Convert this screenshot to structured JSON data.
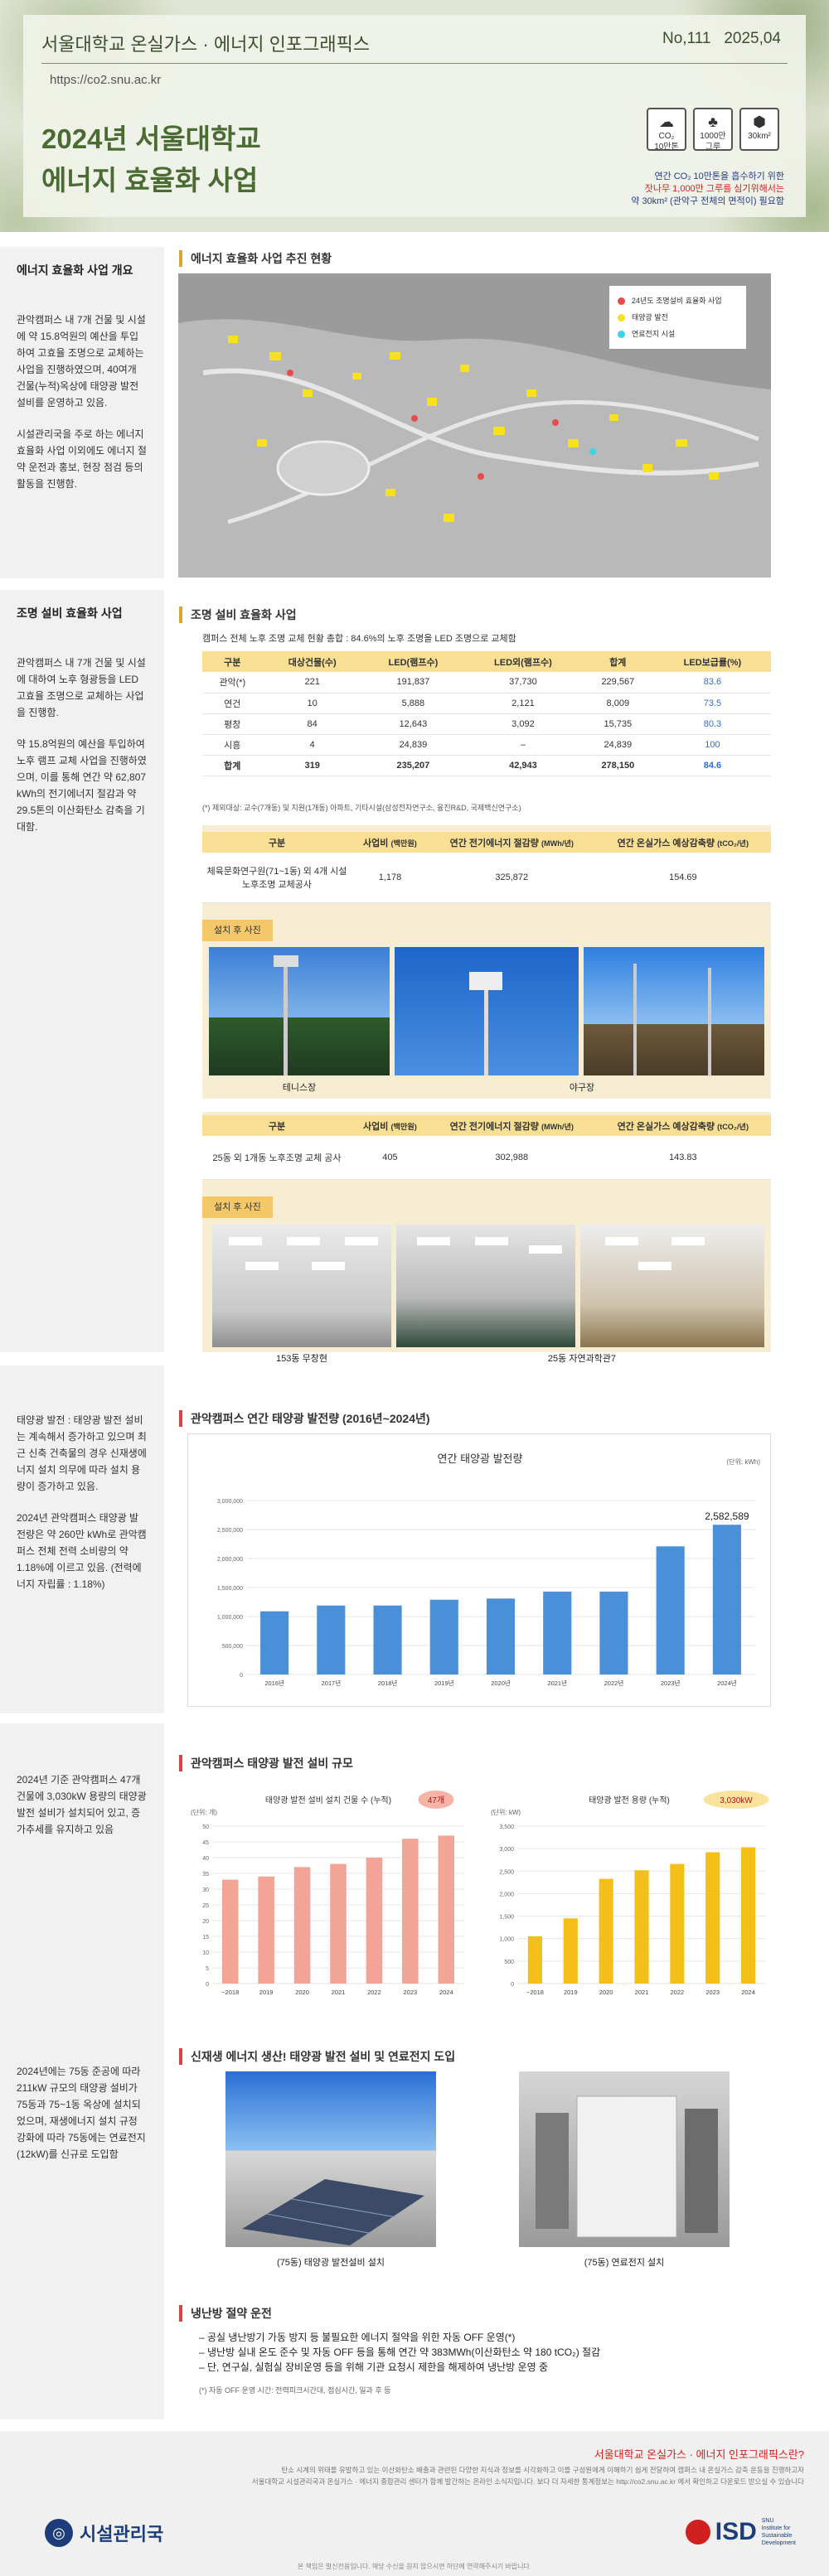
{
  "header": {
    "title": "서울대학교 온실가스 · 에너지 인포그래픽스",
    "number": "No,111",
    "date": "2025,04",
    "url": "https://co2.snu.ac.kr",
    "main_line1": "2024년 서울대학교",
    "main_line2": "에너지 효율화 사업",
    "badges": [
      {
        "icon": "co2-cloud-icon",
        "value": "CO₂",
        "sub": "10만톤"
      },
      {
        "icon": "tree-icon",
        "value": "1000만",
        "sub": "그루"
      },
      {
        "icon": "area-icon",
        "value": "30km²",
        "sub": ""
      }
    ],
    "note_line1": "연간 CO₂ 10만톤을 흡수하기 위한",
    "note_line2": "잣나무 1,000만 그루를 심기위해서는",
    "note_line3": "약 30km² (관악구 전체의 면적이) 필요함"
  },
  "section1": {
    "side_title": "에너지 효율화 사업 개요",
    "side_p1": "관악캠퍼스 내 7개 건물 및 시설에 약 15.8억원의 예산을 투입하여 고효율 조명으로 교체하는 사업을 진행하였으며, 40여개 건물(누적)옥상에 태양광 발전 설비를 운영하고 있음.",
    "side_p2": "시설관리국을 주로 하는 에너지 효율화 사업 이외에도 에너지 절약 운전과 홍보, 현장 점검 등의 활동을 진행함.",
    "title": "에너지 효율화 사업 추진 현황",
    "legend": [
      {
        "label": "24년도 조명설비 효율화 사업",
        "color": "#e84b4b"
      },
      {
        "label": "태양광 발전",
        "color": "#f6e11a"
      },
      {
        "label": "연료전지 시설",
        "color": "#38d4e8"
      }
    ]
  },
  "section2": {
    "side_title": "조명 설비 효율화 사업",
    "side_p1": "관악캠퍼스 내 7개 건물 및 시설에 대하여 노후 형광등을 LED 고효율 조명으로 교체하는 사업을 진행함.",
    "side_p2": "약 15.8억원의 예산을 투입하여 노후 램프 교체 사업을 진행하였으며, 이를 통해 연간 약 62,807 kWh의 전기에너지 절감과 약 29.5톤의 이산화탄소 감축을 기대함.",
    "title": "조명 설비 효율화 사업",
    "table_title": "캠퍼스 전체 노후 조명 교체 현황 총합 : 84.6%의 노후 조명을 LED 조명으로 교체함",
    "table_headers": [
      "구분",
      "대상건물(수)",
      "LED(램프수)",
      "LED외(램프수)",
      "합계",
      "LED보급률(%)"
    ],
    "table_rows": [
      [
        "관악(*)",
        "221",
        "191,837",
        "37,730",
        "229,567",
        "83.6"
      ],
      [
        "연건",
        "10",
        "5,888",
        "2,121",
        "8,009",
        "73.5"
      ],
      [
        "평창",
        "84",
        "12,643",
        "3,092",
        "15,735",
        "80.3"
      ],
      [
        "시흥",
        "4",
        "24,839",
        "–",
        "24,839",
        "100"
      ],
      [
        "합계",
        "319",
        "235,207",
        "42,943",
        "278,150",
        "84.6"
      ]
    ],
    "table_note": "(*) 제외대상: 교수(7개동) 및 지원(1개동) 아파트, 기타시설(삼성전자연구소, 융진R&D, 국제백신연구소)",
    "proj1_headers": [
      "구분",
      "사업비",
      "연간 전기에너지 절감량",
      "연간 온실가스 예상감축량"
    ],
    "proj1_units": [
      "",
      "(백만원)",
      "(MWh/년)",
      "(tCO₂/년)"
    ],
    "proj1_row": [
      "체육문화연구원(71~1동) 외 4개 시설 노후조명 교체공사",
      "1,178",
      "325,872",
      "154.69"
    ],
    "ribbon1": "설치 후 사진",
    "photo1_caption_a": "테니스장",
    "photo1_caption_b": "야구장",
    "proj2_headers": [
      "구분",
      "사업비",
      "연간 전기에너지 절감량",
      "연간 온실가스 예상감축량"
    ],
    "proj2_units": [
      "",
      "(백만원)",
      "(MWh/년)",
      "(tCO₂/년)"
    ],
    "proj2_row": [
      "25동 외 1개동 노후조명 교체 공사",
      "405",
      "302,988",
      "143.83"
    ],
    "ribbon2": "설치 후 사진",
    "photo2_caption_a": "153동 무창현",
    "photo2_caption_b": "25동 자연과학관7"
  },
  "section3": {
    "side_p1": "태양광 발전 : 태양광 발전 설비는 계속해서 증가하고 있으며 최근 신축 건축물의 경우 신재생에너지 설치 의무에 따라 설치 용량이 증가하고 있음.",
    "side_p2": "2024년 관악캠퍼스 태양광 발전량은 약 260만 kWh로 관악캠퍼스 전체 전력 소비량의 약 1.18%에 이르고 있음. (전력에너지 자립률 : 1.18%)",
    "title": "관악캠퍼스 연간 태양광 발전량 (2016년~2024년)"
  },
  "chart_data": [
    {
      "type": "bar",
      "title": "연간 태양광 발전량",
      "unit": "(단위: kWh)",
      "categories": [
        "2016년",
        "2017년",
        "2018년",
        "2019년",
        "2020년",
        "2021년",
        "2022년",
        "2023년",
        "2024년"
      ],
      "values": [
        1090000,
        1190000,
        1190000,
        1290000,
        1310000,
        1430000,
        1430000,
        2210000,
        2582589
      ],
      "ylim": [
        0,
        3000000
      ],
      "yticks": [
        "0",
        "500,000",
        "1,000,000",
        "1,500,000",
        "2,000,000",
        "2,500,000",
        "3,000,000"
      ],
      "label": "2,582,589",
      "color": "#4a90d9"
    },
    {
      "type": "bar",
      "title": "태양광 발전 설비 설치 건물 수 (누적)",
      "badge": "47개",
      "unit": "(단위: 개)",
      "categories": [
        "~2018",
        "2019",
        "2020",
        "2021",
        "2022",
        "2023",
        "2024"
      ],
      "values": [
        33,
        34,
        37,
        38,
        40,
        46,
        47
      ],
      "ylim": [
        0,
        50
      ],
      "yticks": [
        "0",
        "5",
        "10",
        "15",
        "20",
        "25",
        "30",
        "35",
        "40",
        "45",
        "50"
      ],
      "color": "#f2a596"
    },
    {
      "type": "bar",
      "title": "태양광 발전 용량 (누적)",
      "badge": "3,030kW",
      "unit": "(단위: kW)",
      "categories": [
        "~2018",
        "2019",
        "2020",
        "2021",
        "2022",
        "2023",
        "2024"
      ],
      "values": [
        1050,
        1450,
        2330,
        2520,
        2660,
        2920,
        3030
      ],
      "ylim": [
        0,
        3500
      ],
      "yticks": [
        "0",
        "500",
        "1,000",
        "1,500",
        "2,000",
        "2,500",
        "3,000",
        "3,500"
      ],
      "color": "#f5bf1a"
    }
  ],
  "section4": {
    "side_p1": "2024년 기준 관악캠퍼스 47개 건물에 3,030kW 용량의 태양광 발전 설비가 설치되어 있고, 증가추세를 유지하고 있음",
    "title": "관악캠퍼스 태양광 발전 설비 규모"
  },
  "section5": {
    "side_p1": "2024년에는 75동 준공에 따라 211kW 규모의 태양광 설비가 75동과 75~1동 옥상에 설치되었으며, 재생에너지 설치 규정 강화에 따라 75동에는 연료전지(12kW)를 신규로 도입함",
    "title": "신재생 에너지 생산! 태양광 발전 설비 및 연료전지 도입",
    "caption_a": "(75동) 태양광 발전설비 설치",
    "caption_b": "(75동) 연료전지 설치"
  },
  "section6": {
    "title": "냉난방 절약 운전",
    "items": [
      "공실 냉난방기 가동 방지 등 불필요한 에너지 절약을 위한 자동 OFF 운영(*)",
      "냉난방 실내 온도 준수 및 자동 OFF 등을 통해 연간 약 383MWh(이산화탄소 약 180 tCO₂) 절감",
      "단, 연구실, 실험실 장비운영 등을 위해 기관 요청시 제한을 해제하여 냉난방 운영 중"
    ],
    "note": "(*) 자동 OFF 운영 시간: 전력피크시간대, 점심시간, 일과 후 등"
  },
  "footer": {
    "q_title": "서울대학교 온실가스 · 에너지 인포그래픽스란?",
    "q_line1": "탄소 시계의 위태를 유발하고 있는 이산화탄소 배출과 관련된 다양한 지식과 정보를 시각화하고 이를 구성원에게 이해하기 쉽게 전달하여 캠퍼스 내 온실가스 감축 운동을 진행하고자",
    "q_line2": "서울대학교 시설관리국과 온실가스 · 에너지 종합관리 센터가 함께 발간하는 온라인 소식지입니다. 보다 더 자세한 통계정보는 http://co2.snu.ac.kr 에서 확인하고 다운로드 받으실 수 있습니다",
    "logo_left": "시설관리국",
    "logo_right": "ISD",
    "logo_right_sub1": "SNU",
    "logo_right_sub2": "Institute for",
    "logo_right_sub3": "Sustainable",
    "logo_right_sub4": "Development",
    "copyright": "본 책임은 발신전용입니다. 해당 수신을 원치 않으시면 하단에 연락해주시기 바랍니다."
  }
}
